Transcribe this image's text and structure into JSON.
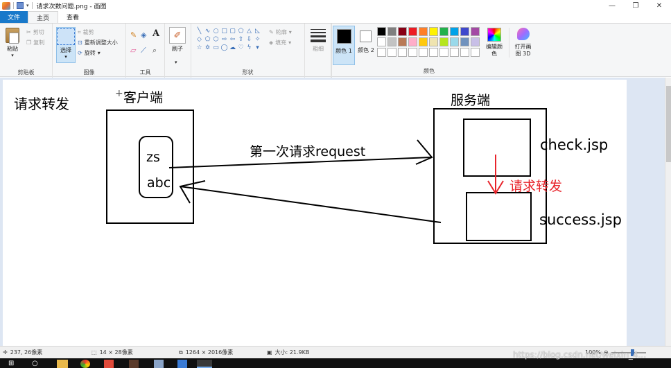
{
  "window": {
    "title": "请求次数问题.png - 画图",
    "minimize": "—",
    "maximize": "❐",
    "close": "✕"
  },
  "tabs": [
    "文件",
    "主页",
    "查看"
  ],
  "ribbon": {
    "clipboard": {
      "paste": "粘贴",
      "cut": "剪切",
      "copy": "复制",
      "label": "剪贴板"
    },
    "image": {
      "select": "选择",
      "crop": "裁剪",
      "resize": "重新调整大小",
      "rotate": "旋转",
      "label": "图像"
    },
    "tools": {
      "label": "工具",
      "text_tool": "A"
    },
    "brushes": {
      "label": "刷子"
    },
    "shapes": {
      "outline": "轮廓",
      "fill": "填充",
      "label": "形状"
    },
    "size": {
      "label": "粗细"
    },
    "color1": {
      "label": "颜色 1",
      "value": "#000000"
    },
    "color2": {
      "label": "颜色 2",
      "value": "#ffffff"
    },
    "edit_colors": "编辑颜色",
    "paint3d": "打开画图 3D",
    "colors_label": "颜色",
    "palette": [
      "#000000",
      "#7f7f7f",
      "#880015",
      "#ed1c24",
      "#ff7f27",
      "#fff200",
      "#22b14c",
      "#00a2e8",
      "#3f48cc",
      "#a349a4",
      "#ffffff",
      "#c3c3c3",
      "#b97a57",
      "#ffaec9",
      "#ffc90e",
      "#efe4b0",
      "#b5e61d",
      "#99d9ea",
      "#7092be",
      "#c8bfe7",
      "#ffffff",
      "#ffffff",
      "#ffffff",
      "#ffffff",
      "#ffffff",
      "#ffffff",
      "#ffffff",
      "#ffffff",
      "#ffffff",
      "#ffffff"
    ]
  },
  "drawing": {
    "heading": "请求转发",
    "client_label": "客户端",
    "server_label": "服务端",
    "client_value_1": "zs",
    "client_value_2": "abc",
    "arrow_label": "第一次请求request",
    "page_1": "check.jsp",
    "page_2": "success.jsp",
    "forward_label": "请求转发",
    "ink_color": "#000000",
    "forward_color": "#e8242b"
  },
  "status": {
    "cursor": "237, 26像素",
    "selection": "14 × 28像素",
    "image_size": "1264 × 2016像素",
    "file_size": "大小: 21.9KB",
    "zoom": "100%"
  },
  "watermark": "https://blog.csdn.net/weixin_4..."
}
